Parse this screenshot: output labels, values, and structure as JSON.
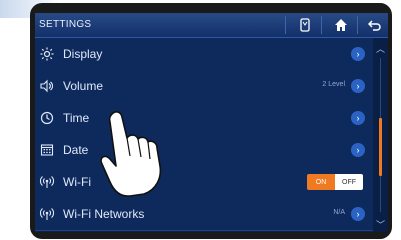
{
  "header": {
    "title": "SETTINGS",
    "icons": [
      "phone-icon",
      "home-icon",
      "back-icon"
    ]
  },
  "settings": [
    {
      "label": "Display",
      "icon": "sun-icon",
      "value": ""
    },
    {
      "label": "Volume",
      "icon": "speaker-icon",
      "value": "2 Level"
    },
    {
      "label": "Time",
      "icon": "clock-icon",
      "value": ""
    },
    {
      "label": "Date",
      "icon": "calendar-icon",
      "value": ""
    },
    {
      "label": "Wi-Fi",
      "icon": "wifi-icon",
      "toggle": {
        "on": "ON",
        "off": "OFF",
        "state": "on"
      }
    },
    {
      "label": "Wi-Fi Networks",
      "icon": "wifi-icon",
      "value": "N/A"
    }
  ],
  "colors": {
    "accent": "#f07a21",
    "screen_bg": "#0b2550",
    "chevron": "#2b63c4"
  }
}
